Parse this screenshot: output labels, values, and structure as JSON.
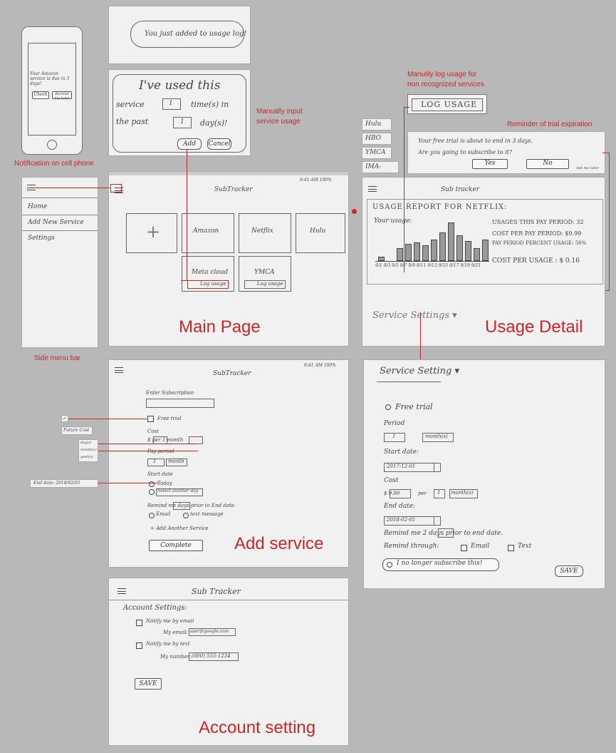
{
  "labels": {
    "notification": "Notification on cell phone",
    "manual_input": "Manually input service usage",
    "manual_log": "Manulily log usage for non recognized services",
    "trial_reminder": "Reminder of trial expiration",
    "side_menu": "Side menu bar",
    "main_page": "Main Page",
    "usage_detail": "Usage Detail",
    "add_service": "Add service",
    "account_setting": "Account setting"
  },
  "phone": {
    "message": "Your Amazon service is due in 3 days!",
    "btn_check": "Check",
    "btn_remind": "Remind me later"
  },
  "toast": {
    "text": "You just added to usage log!"
  },
  "usage_input": {
    "line1": "I've used this",
    "line2a": "service",
    "times_value": "1",
    "line2b": "time(s) in",
    "line3a": "the past",
    "days_value": "1",
    "line3b": "day(s)!",
    "add": "Add",
    "cancel": "Cancel"
  },
  "side_menu": {
    "items": [
      "Home",
      "Add New Service",
      "Settings"
    ]
  },
  "main_page": {
    "title": "SubTracker",
    "status": "9:41 AM   100%",
    "add_tile": "+",
    "tiles": [
      "Amazon",
      "Netflix",
      "Hulu"
    ],
    "tiles_row2": [
      "Meta cloud",
      "YMCA"
    ],
    "log_usage": "Log usage"
  },
  "log_usage": {
    "button": "LOG USAGE",
    "list": [
      "Hulu",
      "HBO",
      "YMCA",
      "IMA-"
    ]
  },
  "trial": {
    "line1": "Your free trial is about to end in 3 days.",
    "line2": "Are you going to subscribe to it?",
    "yes": "Yes",
    "no": "No",
    "later": "Ask me later"
  },
  "usage_detail": {
    "title": "Sub tracker",
    "report": "USAGE REPORT FOR NETFLIX:",
    "your_usage": "Your usage:",
    "stat1": "USAGES THIS PAY PERIOD: 32",
    "stat2": "COST PER PAY PERIOD: $9.99",
    "stat3": "PAY PERIOD PERCENT USAGE: 50%",
    "stat4": "COST PER USAGE : $ 0.16",
    "settings_link": "Service Settings ▾",
    "bar_labels": "9/1 9/3 9/5 9/7 9/9 9/11 9/13 9/15 9/17 9/19 9/21"
  },
  "service_setting": {
    "title": "Service Setting ▾",
    "free_trial": "Free trial",
    "period_label": "Period",
    "period_value": "1",
    "period_unit": "month(s)",
    "start_label": "Start date:",
    "start_value": "2017-12-01",
    "cost_label": "Cost",
    "cost_value": "$ 9.99",
    "per": "per",
    "cost_n": "1",
    "cost_unit": "month(s)",
    "end_label": "End date:",
    "end_value": "2018-02-01",
    "remind_line": "Remind me  2  days prior to end date.",
    "remind_through": "Remind through:",
    "email": "Email",
    "text": "Text",
    "no_longer": "I no longer subscribe this!",
    "save": "SAVE"
  },
  "add_service": {
    "title": "SubTracker",
    "status": "9:41 AM   100%",
    "enter_label": "Enter Subscription",
    "free_trial": "Free trial",
    "cost_label": "Cost",
    "cost_row": "$        per  1  month",
    "pay_label": "Pay period",
    "pay_value": "1",
    "pay_unit": "month",
    "start_label": "Start date",
    "today": "Today",
    "select_another": "Select another day",
    "remind_line": "Remind me        days prior to End date.",
    "email": "Email",
    "text": "text message",
    "add_another": "+ Add Another Service",
    "complete": "Complete",
    "side_check": "✓",
    "future_cost": "Future Cost",
    "units": [
      "day(s)",
      "month(s)",
      "year(s)"
    ],
    "end_date": "End date: 2018/02/01"
  },
  "account": {
    "title": "Sub Tracker",
    "heading": "Account Settings:",
    "notify_email": "Notify me by email",
    "email_label": "My email:",
    "email_value": "user@google.com",
    "notify_text": "Notify me by text",
    "number_label": "My number:",
    "number_value": "(000) 555-1234",
    "save": "SAVE"
  }
}
